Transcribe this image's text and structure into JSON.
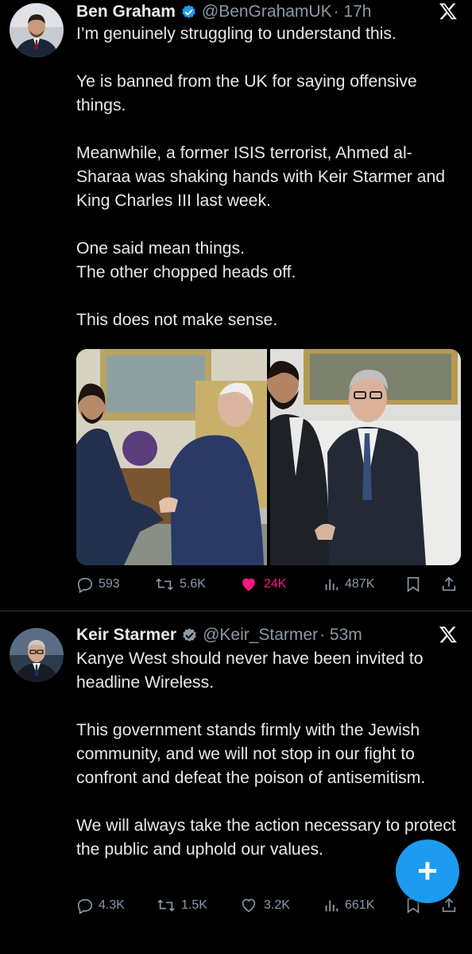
{
  "tweets": [
    {
      "name": "Ben Graham",
      "handle": "@BenGrahamUK",
      "time": "· 17h",
      "text": "I’m genuinely struggling to understand this.\n\nYe is banned from the UK for saying offensive things.\n\nMeanwhile, a former ISIS terrorist, Ahmed al-Sharaa was shaking hands with Keir Starmer and King Charles III last week.\n\nOne said mean things.\nThe other chopped heads off.\n\nThis does not make sense.",
      "stats": {
        "replies": "593",
        "reposts": "5.6K",
        "likes": "24K",
        "views": "487K"
      },
      "liked": true
    },
    {
      "name": "Keir Starmer",
      "handle": "@Keir_Starmer",
      "time": "· 53m",
      "text": "Kanye West should never have been invited to headline Wireless.\n\nThis government stands firmly with the Jewish community, and we will not stop in our fight to confront and defeat the poison of antisemitism.\n\nWe will always take the action necessary to protect the public and uphold our values.",
      "stats": {
        "replies": "4.3K",
        "reposts": "1.5K",
        "likes": "3.2K",
        "views": "661K"
      },
      "liked": false
    }
  ],
  "compose": {
    "icon": "plus-icon"
  },
  "colors": {
    "like_active": "#f91880",
    "accent": "#1d9bf0",
    "muted": "#8b98a5"
  }
}
